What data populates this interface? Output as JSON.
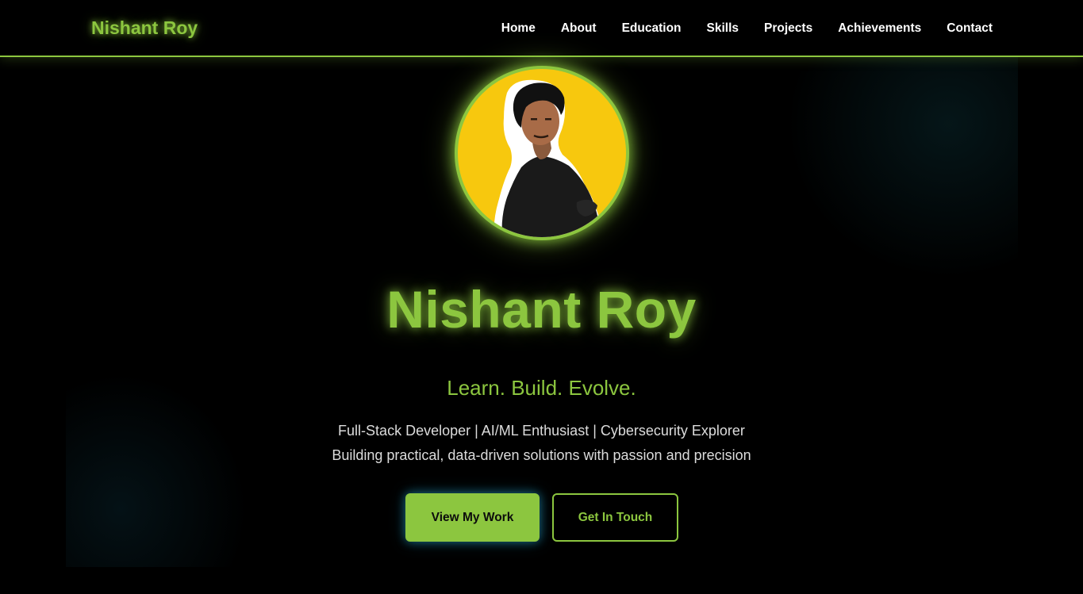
{
  "nav": {
    "brand": "Nishant Roy",
    "links": [
      "Home",
      "About",
      "Education",
      "Skills",
      "Projects",
      "Achievements",
      "Contact"
    ]
  },
  "hero": {
    "avatar_alt": "Nishant Roy profile photo",
    "name": "Nishant Roy",
    "tagline": "Learn. Build. Evolve.",
    "roles": "Full-Stack Developer | AI/ML Enthusiast | Cybersecurity Explorer",
    "subtitle": "Building practical, data-driven solutions with passion and precision",
    "primary_button": "View My Work",
    "secondary_button": "Get In Touch"
  },
  "colors": {
    "accent": "#8cc63f",
    "background": "#000000",
    "avatar_bg": "#f7c80e",
    "text": "#dcdcdc"
  }
}
